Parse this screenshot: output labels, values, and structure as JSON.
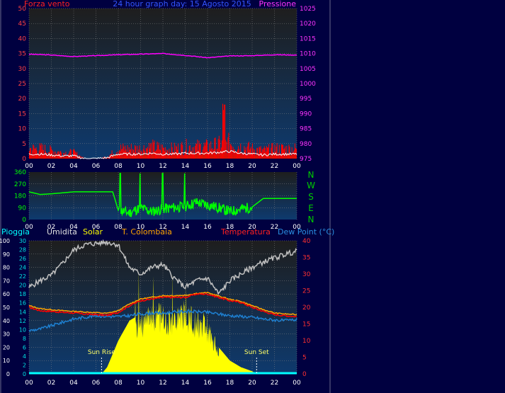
{
  "header": {
    "wind_label": "Forza vento",
    "title": "24 hour graph day: 15 Agosto 2015",
    "pressure_label": "Pressione"
  },
  "compass": [
    "N",
    "W",
    "S",
    "E",
    "N"
  ],
  "bottom_legend": {
    "rain": "Pioggia",
    "humidity": "Umidita",
    "solar": "Solar",
    "indoor_temp": "T. Colombaia",
    "temperature": "Temperatura",
    "dewpoint": "Dew Point (°C)"
  },
  "sun_labels": {
    "rise": "Sun Rise",
    "set": "Sun Set"
  },
  "colors": {
    "background": "#000040",
    "plot_top": "#1e1e1e",
    "plot_bottom": "#0e3a6e",
    "wind_speed": "#ff0000",
    "wind_avg": "#ffffff",
    "wind_gust_area": "#008000",
    "pressure": "#ff00ff",
    "direction": "#00ff00",
    "humidity": "#c0c0c0",
    "solar": "#ffff00",
    "temperature": "#ff0000",
    "indoor_temp": "#ffa500",
    "dewpoint": "#1e7fd0",
    "rain": "#00ffff"
  },
  "chart_data": [
    {
      "type": "line",
      "panel": "wind-pressure",
      "x_ticks": [
        "00",
        "02",
        "04",
        "06",
        "08",
        "10",
        "12",
        "14",
        "16",
        "18",
        "20",
        "22",
        "00"
      ],
      "y_left_ticks": [
        0,
        5,
        10,
        15,
        20,
        25,
        30,
        35,
        40,
        45,
        50
      ],
      "y_right_ticks": [
        975,
        980,
        985,
        990,
        995,
        1000,
        1005,
        1010,
        1015,
        1020,
        1025
      ],
      "ylim_left": [
        0,
        50
      ],
      "ylim_right": [
        975,
        1025
      ],
      "grid": true,
      "series": [
        {
          "name": "Pressione",
          "axis": "right",
          "x": [
            0,
            2,
            4,
            6,
            8,
            10,
            12,
            14,
            16,
            18,
            20,
            22,
            24
          ],
          "values": [
            1009.8,
            1009.5,
            1009.0,
            1009.3,
            1009.6,
            1009.8,
            1010.0,
            1009.4,
            1008.6,
            1009.2,
            1009.3,
            1009.6,
            1009.5
          ]
        },
        {
          "name": "Forza vento",
          "axis": "left",
          "x": [
            0,
            1,
            2,
            3,
            4,
            5,
            6,
            7,
            8,
            9,
            10,
            11,
            12,
            13,
            14,
            15,
            16,
            17,
            18,
            19,
            20,
            21,
            22,
            23,
            24
          ],
          "values": [
            5,
            5,
            4,
            3,
            3,
            0,
            0,
            1,
            5,
            5,
            5,
            6,
            5,
            5,
            6,
            6,
            6,
            7,
            8,
            6,
            5,
            4,
            5,
            5,
            5
          ]
        }
      ]
    },
    {
      "type": "line",
      "panel": "wind-direction",
      "x_ticks": [
        "00",
        "02",
        "04",
        "06",
        "08",
        "10",
        "12",
        "14",
        "16",
        "18",
        "20",
        "22",
        "00"
      ],
      "y_ticks": [
        0,
        90,
        180,
        270,
        360
      ],
      "ylim": [
        0,
        360
      ],
      "series": [
        {
          "name": "direction",
          "x": [
            0,
            1,
            2,
            4,
            6,
            7.5,
            8,
            9,
            10,
            11,
            12,
            13,
            14,
            15,
            16,
            17,
            18,
            19,
            20,
            21,
            22,
            23,
            24
          ],
          "values": [
            210,
            190,
            195,
            210,
            210,
            210,
            70,
            50,
            90,
            60,
            80,
            90,
            100,
            130,
            110,
            90,
            60,
            80,
            95,
            160,
            160,
            160,
            160
          ]
        }
      ]
    },
    {
      "type": "line",
      "panel": "weather",
      "x_ticks": [
        "00",
        "02",
        "04",
        "06",
        "08",
        "10",
        "12",
        "14",
        "16",
        "18",
        "20",
        "22",
        "00"
      ],
      "y_pct_ticks": [
        0,
        10,
        20,
        30,
        40,
        50,
        60,
        70,
        80,
        90,
        100
      ],
      "y_mid_ticks": [
        0,
        2,
        4,
        6,
        8,
        10,
        12,
        14,
        16,
        18,
        20,
        22,
        24,
        26,
        28,
        30
      ],
      "y_right_ticks": [
        0,
        5,
        10,
        15,
        20,
        25,
        30,
        35,
        40
      ],
      "ylim_pct": [
        0,
        100
      ],
      "ylim_temp": [
        0,
        40
      ],
      "sunrise_hour": 6.5,
      "sunset_hour": 20.4,
      "series": [
        {
          "name": "Umidita",
          "axis": "pct",
          "x": [
            0,
            1,
            2,
            3,
            4,
            5,
            6,
            7,
            8,
            9,
            10,
            11,
            12,
            13,
            14,
            15,
            16,
            17,
            18,
            19,
            20,
            21,
            22,
            23,
            24
          ],
          "values": [
            65,
            70,
            74,
            83,
            93,
            97,
            98,
            99,
            97,
            80,
            75,
            80,
            82,
            72,
            65,
            70,
            72,
            60,
            70,
            75,
            80,
            84,
            87,
            90,
            92
          ]
        },
        {
          "name": "Temperatura",
          "axis": "temp",
          "x": [
            0,
            1,
            2,
            3,
            4,
            5,
            6,
            7,
            8,
            9,
            10,
            11,
            12,
            13,
            14,
            15,
            16,
            17,
            18,
            19,
            20,
            21,
            22,
            23,
            24
          ],
          "values": [
            20,
            19,
            18.8,
            18.5,
            18.3,
            18,
            17.8,
            17.6,
            18.5,
            20.5,
            22,
            22.5,
            23,
            23,
            23,
            24,
            24,
            23,
            22,
            21.5,
            20,
            18.8,
            17.8,
            17.5,
            17.2
          ]
        },
        {
          "name": "T. Colombaia",
          "axis": "temp",
          "x": [
            0,
            1,
            2,
            3,
            4,
            5,
            6,
            7,
            8,
            9,
            10,
            11,
            12,
            13,
            14,
            15,
            16,
            17,
            18,
            19,
            20,
            21,
            22,
            23,
            24
          ],
          "values": [
            20.5,
            19.6,
            19.3,
            19,
            18.8,
            18.6,
            18.4,
            18.2,
            19,
            21,
            22.5,
            23,
            23.5,
            23.5,
            23.6,
            24.2,
            24.4,
            23.4,
            22.4,
            21.8,
            20.5,
            19.3,
            18.3,
            18,
            17.8
          ]
        },
        {
          "name": "Dew Point (°C)",
          "axis": "temp",
          "x": [
            0,
            1,
            2,
            3,
            4,
            5,
            6,
            7,
            8,
            9,
            10,
            11,
            12,
            13,
            14,
            15,
            16,
            17,
            18,
            19,
            20,
            21,
            22,
            23,
            24
          ],
          "values": [
            13,
            13.5,
            14.5,
            15.5,
            16.5,
            17,
            17.5,
            17.3,
            17.2,
            17.5,
            18,
            18.3,
            18.2,
            18.6,
            18.8,
            18.7,
            18.5,
            18,
            17.5,
            17.3,
            17,
            16.5,
            16.2,
            16,
            16.3
          ]
        },
        {
          "name": "Solar",
          "axis": "pct",
          "x": [
            6.5,
            7,
            8,
            9,
            10,
            10.5,
            11,
            12,
            12.5,
            13,
            14,
            14.5,
            15,
            15.5,
            16,
            17,
            18,
            19,
            20,
            20.4
          ],
          "values": [
            0,
            5,
            25,
            40,
            45,
            45,
            50,
            50,
            47,
            48,
            50,
            48,
            42,
            45,
            38,
            20,
            10,
            5,
            2,
            0
          ]
        },
        {
          "name": "Pioggia",
          "axis": "pct",
          "x": [
            0,
            24
          ],
          "values": [
            0,
            0
          ]
        }
      ]
    }
  ]
}
